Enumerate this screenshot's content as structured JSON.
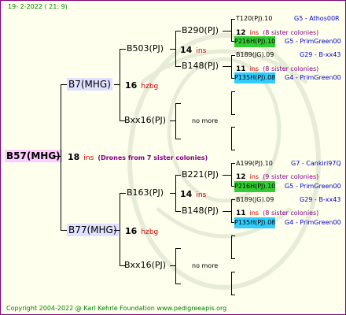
{
  "header": {
    "date": "19-  2-2022 ( 21:  9)"
  },
  "footer": {
    "copyright": "Copyright 2004-2022 @ Karl Kehrle Foundation    www.pedigreeapis.org"
  },
  "root": {
    "name": "B57(MHG)",
    "num": "18",
    "ins": "ins",
    "drones": "(Drones from 7 sister colonies)"
  },
  "p1": {
    "name": "B7(MHG)",
    "num": "16",
    "label": "hzbg"
  },
  "p2": {
    "name": "B77(MHG)",
    "num": "16",
    "label": "hzbg"
  },
  "g1": {
    "name": "B503(PJ)",
    "num": "14",
    "ins": "ins"
  },
  "g2": {
    "name": "Bxx16(PJ)",
    "nomore": "no more"
  },
  "g3": {
    "name": "B163(PJ)",
    "num": "14",
    "ins": "ins"
  },
  "g4": {
    "name": "Bxx16(PJ)",
    "nomore": "no more"
  },
  "gg1": {
    "name": "B290(PJ)"
  },
  "gg2": {
    "name": "B148(PJ)"
  },
  "gg3": {
    "name": "B221(PJ)"
  },
  "gg4": {
    "name": "B148(PJ)"
  },
  "ggg": {
    "a": {
      "name": "T120(PJ).10",
      "right": "G5 - Athos00R"
    },
    "a_line": {
      "num": "12",
      "ins": "ins",
      "sis": "(8 sister colonies)"
    },
    "a2": {
      "name": "P216H(PJ).10",
      "right": "G5 - PrimGreen00"
    },
    "b": {
      "name": "B189(JG).09",
      "right": "G29 - B-xx43"
    },
    "b_line": {
      "num": "11",
      "ins": "ins",
      "sis": "(8 sister colonies)"
    },
    "b2": {
      "name": "P135H(PJ).08",
      "right": "G4 - PrimGreen00"
    },
    "c": {
      "name": "A199(PJ).10",
      "right": "G7 - Cankiri97Q"
    },
    "c_line": {
      "num": "12",
      "ins": "ins",
      "sis": "(9 sister colonies)"
    },
    "c2": {
      "name": "P216H(PJ).10",
      "right": "G5 - PrimGreen00"
    },
    "d": {
      "name": "B189(JG).09",
      "right": "G29 - B-xx43"
    },
    "d_line": {
      "num": "11",
      "ins": "ins",
      "sis": "(8 sister colonies)"
    },
    "d2": {
      "name": "P135H(PJ).08",
      "right": "G4 - PrimGreen00"
    }
  },
  "colors": {
    "border": "#800080",
    "green": "#33cc33",
    "cyan": "#33ccff",
    "red": "#cc0000",
    "blue": "#0000cc"
  }
}
